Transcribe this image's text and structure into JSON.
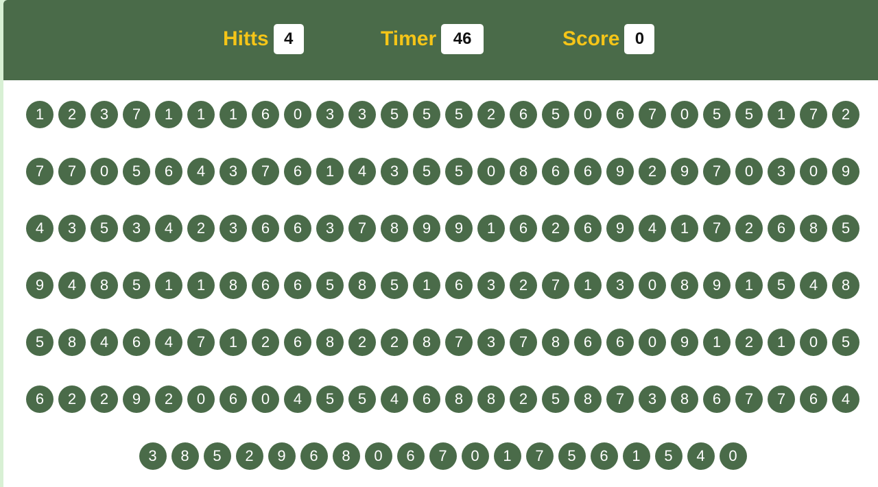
{
  "panel": {
    "hits_label": "Hitts",
    "hits_value": "4",
    "timer_label": "Timer",
    "timer_value": "46",
    "score_label": "Score",
    "score_value": "0"
  },
  "bubbles": [
    "1",
    "2",
    "3",
    "7",
    "1",
    "1",
    "1",
    "6",
    "0",
    "3",
    "3",
    "5",
    "5",
    "5",
    "2",
    "6",
    "5",
    "0",
    "6",
    "7",
    "0",
    "5",
    "5",
    "1",
    "7",
    "2",
    "7",
    "7",
    "0",
    "5",
    "6",
    "4",
    "3",
    "7",
    "6",
    "1",
    "4",
    "3",
    "5",
    "5",
    "0",
    "8",
    "6",
    "6",
    "9",
    "2",
    "9",
    "7",
    "0",
    "3",
    "0",
    "9",
    "4",
    "3",
    "5",
    "3",
    "4",
    "2",
    "3",
    "6",
    "6",
    "3",
    "7",
    "8",
    "9",
    "9",
    "1",
    "6",
    "2",
    "6",
    "9",
    "4",
    "1",
    "7",
    "2",
    "6",
    "8",
    "5",
    "9",
    "4",
    "8",
    "5",
    "1",
    "1",
    "8",
    "6",
    "6",
    "5",
    "8",
    "5",
    "1",
    "6",
    "3",
    "2",
    "7",
    "1",
    "3",
    "0",
    "8",
    "9",
    "1",
    "5",
    "4",
    "8",
    "5",
    "8",
    "4",
    "6",
    "4",
    "7",
    "1",
    "2",
    "6",
    "8",
    "2",
    "2",
    "8",
    "7",
    "3",
    "7",
    "8",
    "6",
    "6",
    "0",
    "9",
    "1",
    "2",
    "1",
    "0",
    "5",
    "6",
    "2",
    "2",
    "9",
    "2",
    "0",
    "6",
    "0",
    "4",
    "5",
    "5",
    "4",
    "6",
    "8",
    "8",
    "2",
    "5",
    "8",
    "7",
    "3",
    "8",
    "6",
    "7",
    "7",
    "6",
    "4",
    "3",
    "8",
    "5",
    "2",
    "9",
    "6",
    "8",
    "0",
    "6",
    "7",
    "0",
    "1",
    "7",
    "5",
    "6",
    "1",
    "5",
    "4",
    "0"
  ],
  "colors": {
    "bubble": "#4a6b49",
    "header": "#4a6b49",
    "label": "#f5c518"
  }
}
